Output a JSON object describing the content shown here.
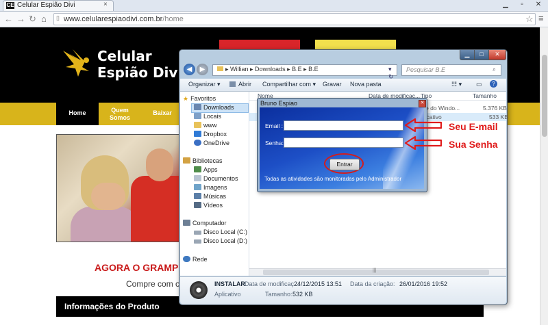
{
  "browser": {
    "tab_title": "Celular Espião Divi",
    "favicon_text": "CE",
    "url_host": "www.celularespiaodivi.com.br",
    "url_path": "/home",
    "close_glyph": "×"
  },
  "site": {
    "logo_line1": "Celular",
    "logo_line2": "Espião Divi",
    "nav": [
      {
        "label": "Home"
      },
      {
        "label": "Quem Somos"
      },
      {
        "label": "Baixar"
      }
    ],
    "headline": "AGORA O GRAMPO",
    "subline": "Compre com cart",
    "info_title": "Informações do Produto",
    "colors": {
      "header": "#000000",
      "navbar": "#d8b41b",
      "headline": "#c91a1a"
    }
  },
  "explorer": {
    "breadcrumb": "▸ Willian ▸ Downloads ▸ B.E ▸ B.E",
    "search_placeholder": "Pesquisar B.E",
    "commands": {
      "organize": "Organizar ▾",
      "open": "Abrir",
      "share": "Compartilhar com ▾",
      "burn": "Gravar",
      "new_folder": "Nova pasta"
    },
    "nav": {
      "favorites": "Favoritos",
      "downloads": "Downloads",
      "places": "Locais",
      "www": "www",
      "dropbox": "Dropbox",
      "onedrive": "OneDrive",
      "libraries": "Bibliotecas",
      "apps": "Apps",
      "documents": "Documentos",
      "images": "Imagens",
      "music": "Músicas",
      "videos": "Vídeos",
      "computer": "Computador",
      "disk_c": "Disco Local (C:)",
      "disk_d": "Disco Local (D:)",
      "network": "Rede"
    },
    "columns": {
      "name": "Nome",
      "date": "Data de modificaç...",
      "type": "Tipo",
      "size": "Tamanho"
    },
    "rows": [
      {
        "type": "ote do Windo...",
        "size": "5.376 KB"
      },
      {
        "type": "plicativo",
        "size": "533 KB"
      }
    ],
    "details": {
      "name": "INSTALAR",
      "kind": "Aplicativo",
      "modified_label": "Data de modificaç...",
      "modified_value": "24/12/2015 13:51",
      "created_label": "Data da criação:",
      "created_value": "26/01/2016 19:52",
      "size_label": "Tamanho:",
      "size_value": "532 KB"
    }
  },
  "dialog": {
    "title": "Bruno Espiao",
    "email_label": "Email :",
    "email_value": "",
    "password_label": "Senha:",
    "password_value": "",
    "enter_button": "Entrar",
    "note": "Todas as atividades são monitoradas pelo Administrador"
  },
  "annotations": {
    "email_hint": "Seu E-mail",
    "password_hint": "Sua Senha",
    "color": "#e01b1b"
  }
}
